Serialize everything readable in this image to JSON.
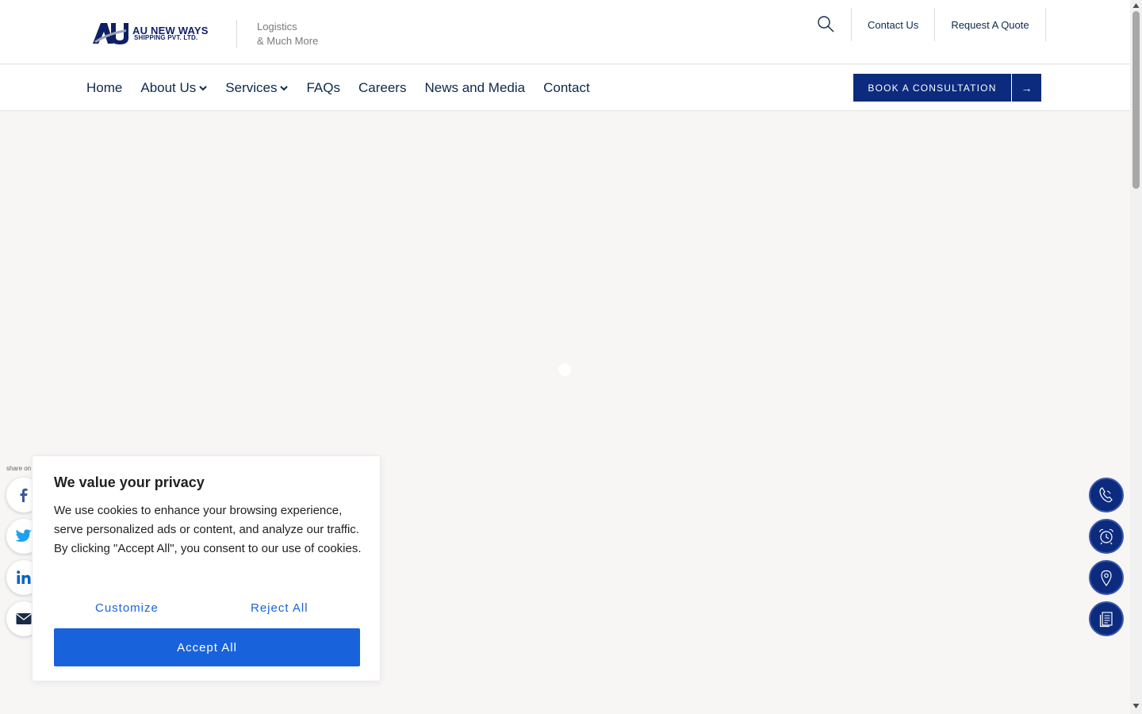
{
  "header": {
    "logo": {
      "mark": "AU",
      "name": "AU NEW WAYS",
      "subtitle": "SHIPPING PVT. LTD."
    },
    "tagline_line1": "Logistics",
    "tagline_line2": "& Much More",
    "top_links": [
      "Contact Us",
      "Request A Quote"
    ]
  },
  "nav": {
    "items": [
      {
        "label": "Home",
        "dropdown": false
      },
      {
        "label": "About Us",
        "dropdown": true
      },
      {
        "label": "Services",
        "dropdown": true
      },
      {
        "label": "FAQs",
        "dropdown": false
      },
      {
        "label": "Careers",
        "dropdown": false
      },
      {
        "label": "News and Media",
        "dropdown": false
      },
      {
        "label": "Contact",
        "dropdown": false
      }
    ],
    "cta_label": "BOOK A CONSULTATION",
    "cta_arrow": "→"
  },
  "share": {
    "label": "share on",
    "icons": [
      "facebook-icon",
      "twitter-icon",
      "linkedin-icon",
      "email-icon"
    ]
  },
  "floating_actions": [
    "phone-icon",
    "alarm-clock-icon",
    "location-pin-icon",
    "document-icon"
  ],
  "cookie": {
    "title": "We value your privacy",
    "text": "We use cookies to enhance your browsing experience, serve personalized ads or content, and analyze our traffic. By clicking \"Accept All\", you consent to our use of cookies.",
    "customize": "Customize",
    "reject": "Reject All",
    "accept": "Accept All"
  },
  "colors": {
    "brand": "#0c2b7e",
    "cookie_accent": "#1863dc",
    "text": "#0d2a4a",
    "page_bg": "#f7f6f5"
  }
}
